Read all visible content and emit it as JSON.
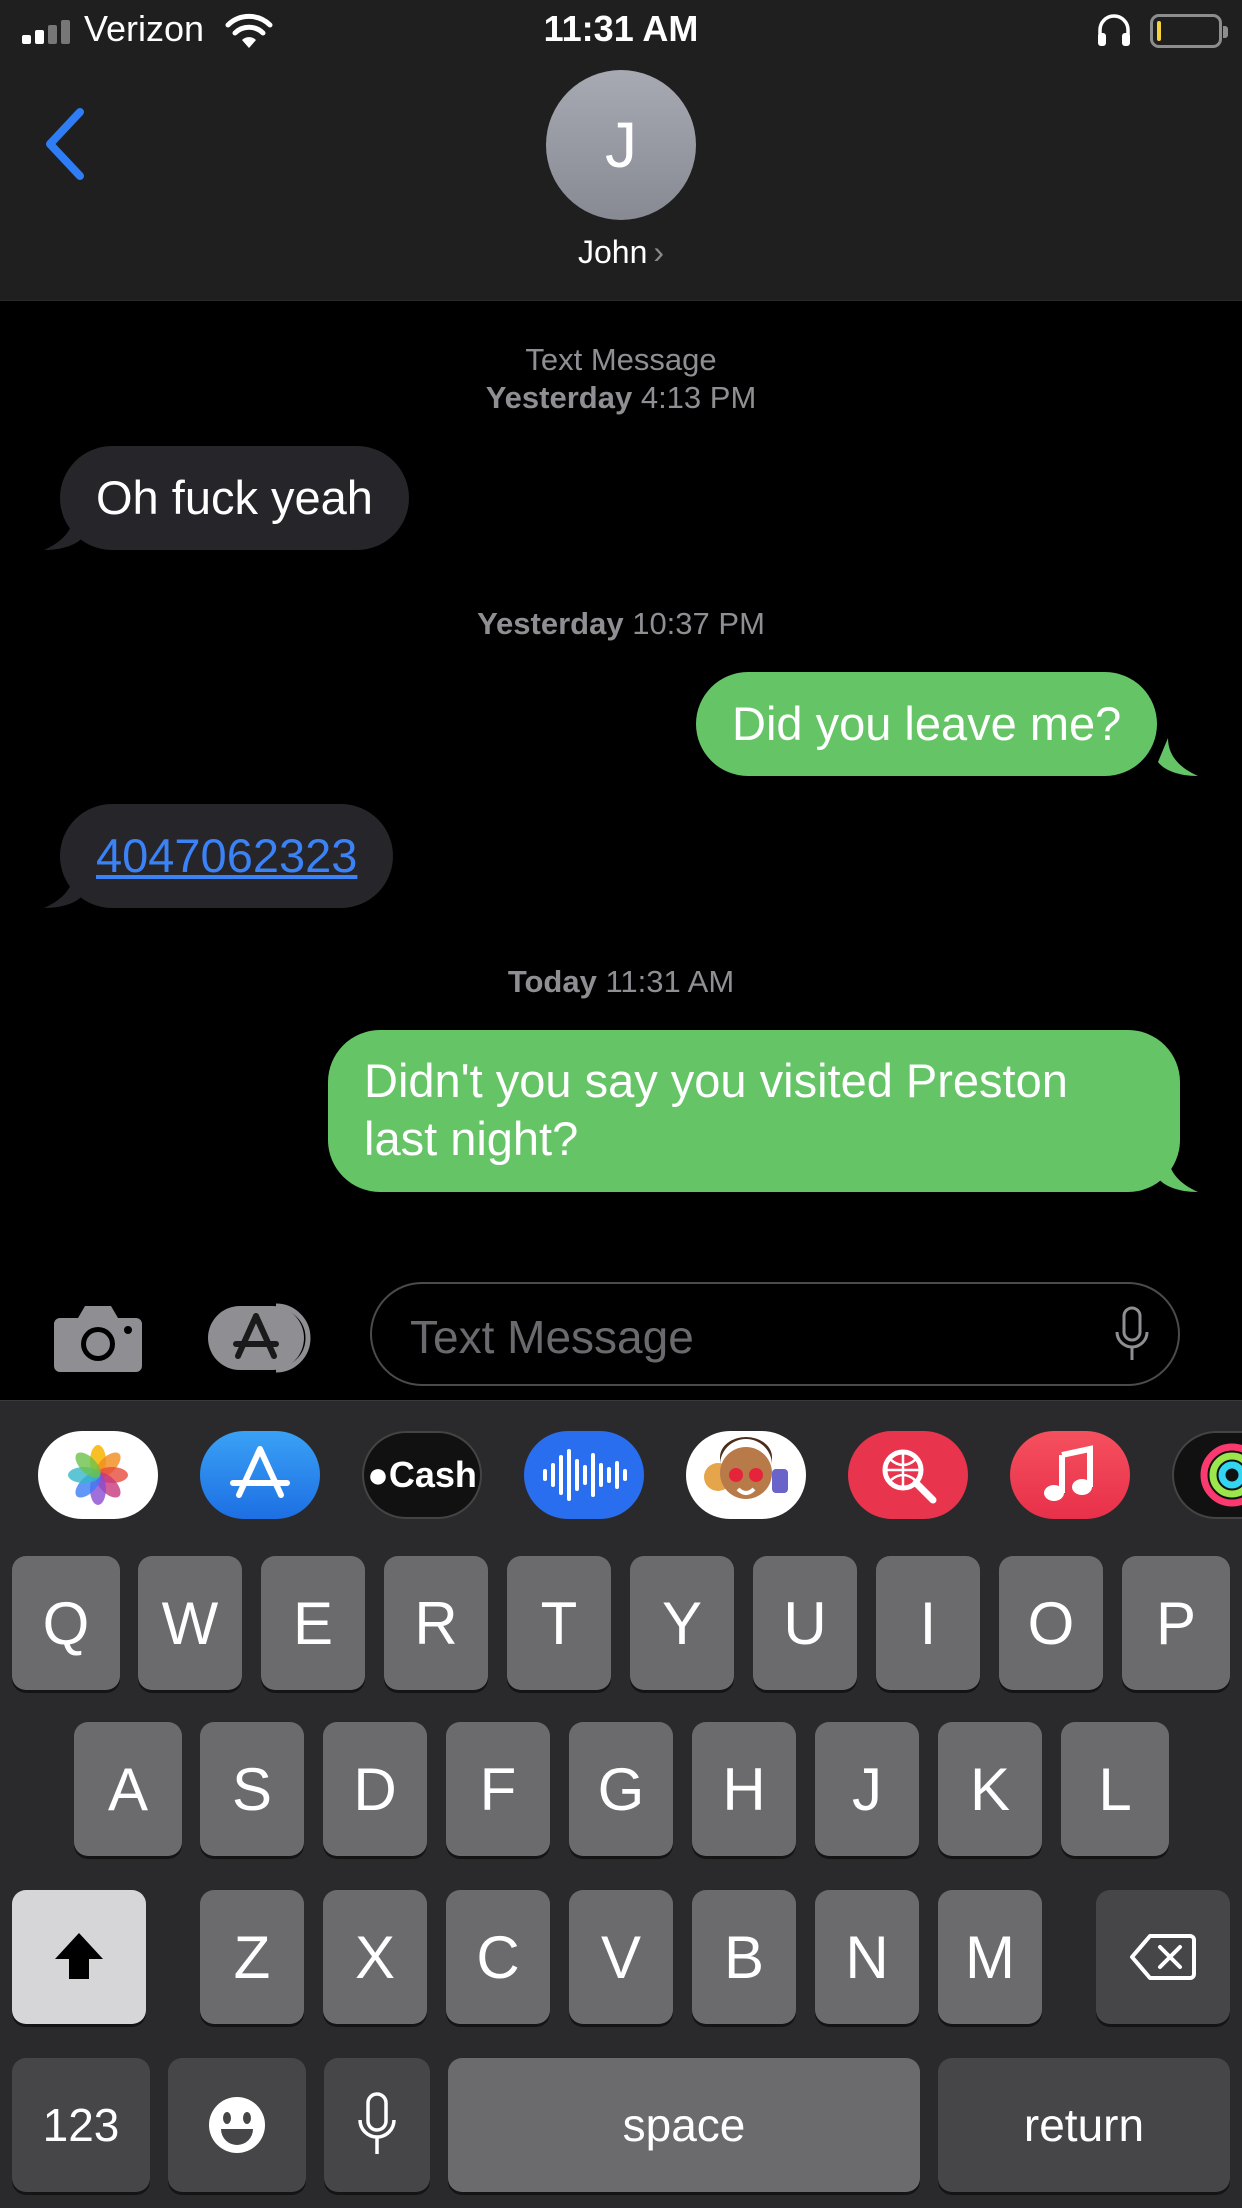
{
  "status_bar": {
    "carrier": "Verizon",
    "time": "11:31 AM",
    "battery_level": 0.05,
    "battery_color": "#f6d33c"
  },
  "header": {
    "avatar_initial": "J",
    "contact_name": "John",
    "chevron": "›"
  },
  "conversation": {
    "service_label": "Text Message",
    "stamp1": {
      "day": "Yesterday",
      "time": "4:13 PM"
    },
    "msg1": "Oh fuck yeah",
    "stamp2": {
      "day": "Yesterday",
      "time": "10:37 PM"
    },
    "msg2": "Did you leave me?",
    "msg3": "4047062323",
    "stamp3": {
      "day": "Today",
      "time": "11:31 AM"
    },
    "msg4_line1": "Didn't you say you visited Preston",
    "msg4_line2": "last night?"
  },
  "compose": {
    "placeholder": "Text Message"
  },
  "app_drawer": {
    "apps": [
      "photos-app-icon",
      "app-store-icon",
      "apple-cash-icon",
      "audio-message-icon",
      "memoji-icon",
      "search-images-icon",
      "music-icon",
      "fitness-icon"
    ],
    "cash_label": "Cash"
  },
  "keyboard": {
    "row1": [
      "Q",
      "W",
      "E",
      "R",
      "T",
      "Y",
      "U",
      "I",
      "O",
      "P"
    ],
    "row2": [
      "A",
      "S",
      "D",
      "F",
      "G",
      "H",
      "J",
      "K",
      "L"
    ],
    "row3": [
      "Z",
      "X",
      "C",
      "V",
      "B",
      "N",
      "M"
    ],
    "numbers_label": "123",
    "space_label": "space",
    "return_label": "return"
  },
  "colors": {
    "outgoing_bubble": "#65c466",
    "incoming_bubble": "#26252a",
    "accent": "#3b82f6"
  }
}
